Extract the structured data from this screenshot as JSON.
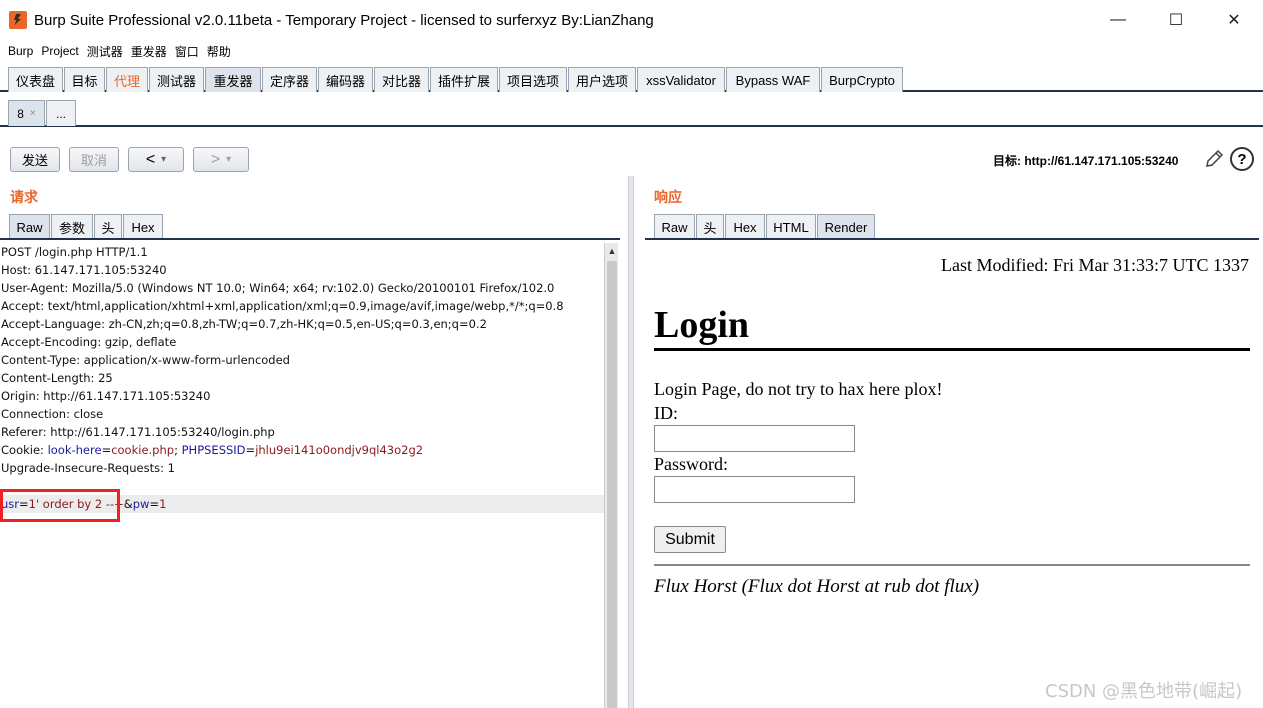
{
  "window": {
    "title": "Burp Suite Professional v2.0.11beta - Temporary Project - licensed to surferxyz By:LianZhang",
    "minimize": "—",
    "maximize": "☐",
    "close": "✕"
  },
  "menu": [
    "Burp",
    "Project",
    "测试器",
    "重发器",
    "窗口",
    "帮助"
  ],
  "main_tabs": [
    "仪表盘",
    "目标",
    "代理",
    "测试器",
    "重发器",
    "定序器",
    "编码器",
    "对比器",
    "插件扩展",
    "项目选项",
    "用户选项",
    "xssValidator",
    "Bypass WAF",
    "BurpCrypto"
  ],
  "repeater_tabs": {
    "current": "8",
    "close": "×",
    "more": "..."
  },
  "toolbar": {
    "send": "发送",
    "cancel": "取消",
    "back": "<",
    "forward": ">",
    "dropdown": "▾",
    "target_label": "目标: http://61.147.171.105:53240",
    "help": "?"
  },
  "request": {
    "label": "请求",
    "tabs": [
      "Raw",
      "参数",
      "头",
      "Hex"
    ],
    "lines": [
      "POST /login.php HTTP/1.1",
      "Host: 61.147.171.105:53240",
      "User-Agent: Mozilla/5.0 (Windows NT 10.0; Win64; x64; rv:102.0) Gecko/20100101 Firefox/102.0",
      "Accept: text/html,application/xhtml+xml,application/xml;q=0.9,image/avif,image/webp,*/*;q=0.8",
      "Accept-Language: zh-CN,zh;q=0.8,zh-TW;q=0.7,zh-HK;q=0.5,en-US;q=0.3,en;q=0.2",
      "Accept-Encoding: gzip, deflate",
      "Content-Type: application/x-www-form-urlencoded",
      "Content-Length: 25",
      "Origin: http://61.147.171.105:53240",
      "Connection: close",
      "Referer: http://61.147.171.105:53240/login.php"
    ],
    "cookie": {
      "prefix": "Cookie: ",
      "name1": "look-here",
      "eq1": "=",
      "value1": "cookie.php",
      "sep": "; ",
      "name2": "PHPSESSID",
      "eq2": "=",
      "value2": "jhlu9ei141o0ondjv9ql43o2g2"
    },
    "upgrade": "Upgrade-Insecure-Requests: 1",
    "body": {
      "name1": "usr",
      "eq1": "=",
      "value1": "1' order by 2 --+",
      "amp": "&",
      "name2": "pw",
      "eq2": "=",
      "value2": "1"
    },
    "scroll_up": "▲"
  },
  "response": {
    "label": "响应",
    "tabs": [
      "Raw",
      "头",
      "Hex",
      "HTML",
      "Render"
    ],
    "render": {
      "last_modified": "Last Modified: Fri Mar 31:33:7 UTC 1337",
      "heading": "Login",
      "intro": "Login Page, do not try to hax here plox!",
      "id_label": "ID:",
      "password_label": "Password:",
      "submit": "Submit",
      "footer": "Flux Horst (Flux dot Horst at rub dot flux)"
    }
  },
  "watermark": "CSDN @黑色地带(崛起)"
}
